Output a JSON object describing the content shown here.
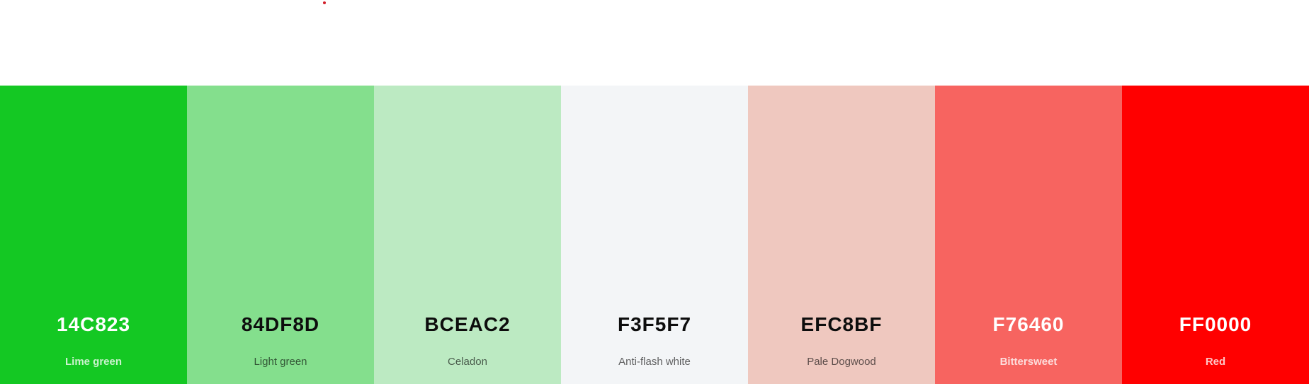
{
  "accent_dot_color": "#D21F2A",
  "palette": {
    "swatches": [
      {
        "hex": "14C823",
        "name": "Lime green",
        "color": "#14C823",
        "text_theme": "light"
      },
      {
        "hex": "84DF8D",
        "name": "Light green",
        "color": "#84DF8D",
        "text_theme": "dark"
      },
      {
        "hex": "BCEAC2",
        "name": "Celadon",
        "color": "#BCEAC2",
        "text_theme": "dark"
      },
      {
        "hex": "F3F5F7",
        "name": "Anti-flash white",
        "color": "#F3F5F7",
        "text_theme": "dark"
      },
      {
        "hex": "EFC8BF",
        "name": "Pale Dogwood",
        "color": "#EFC8BF",
        "text_theme": "dark"
      },
      {
        "hex": "F76460",
        "name": "Bittersweet",
        "color": "#F76460",
        "text_theme": "light"
      },
      {
        "hex": "FF0000",
        "name": "Red",
        "color": "#FF0000",
        "text_theme": "light"
      }
    ]
  }
}
